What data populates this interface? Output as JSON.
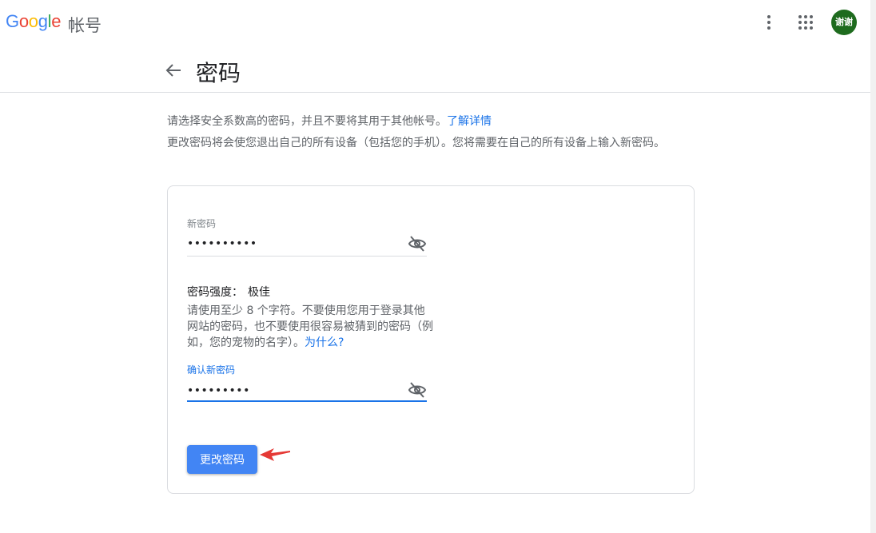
{
  "header": {
    "logo": [
      "G",
      "o",
      "o",
      "g",
      "l",
      "e"
    ],
    "product": "帐号",
    "more_icon": "more-vert-icon",
    "apps_icon": "apps-grid-icon",
    "avatar_text": "谢谢",
    "avatar_color": "#1e6b1e"
  },
  "page": {
    "title": "密码",
    "back_icon": "arrow-back-icon"
  },
  "intro": {
    "line1": "请选择安全系数高的密码，并且不要将其用于其他帐号。",
    "learn_more": "了解详情",
    "line2": "更改密码将会使您退出自己的所有设备（包括您的手机）。您将需要在自己的所有设备上输入新密码。"
  },
  "form": {
    "new_password_label": "新密码",
    "new_password_value": "••••••••••",
    "strength_label": "密码强度：",
    "strength_value": "极佳",
    "hint_text": "请使用至少 8 个字符。不要使用您用于登录其他网站的密码，也不要使用很容易被猜到的密码（例如，您的宠物的名字）。",
    "hint_link": "为什么?",
    "confirm_password_label": "确认新密码",
    "confirm_password_value": "•••••••••",
    "visibility_icon": "visibility-off-icon",
    "submit_label": "更改密码"
  },
  "colors": {
    "accent": "#1a73e8",
    "button": "#4285f4",
    "annotation": "#e53935"
  }
}
